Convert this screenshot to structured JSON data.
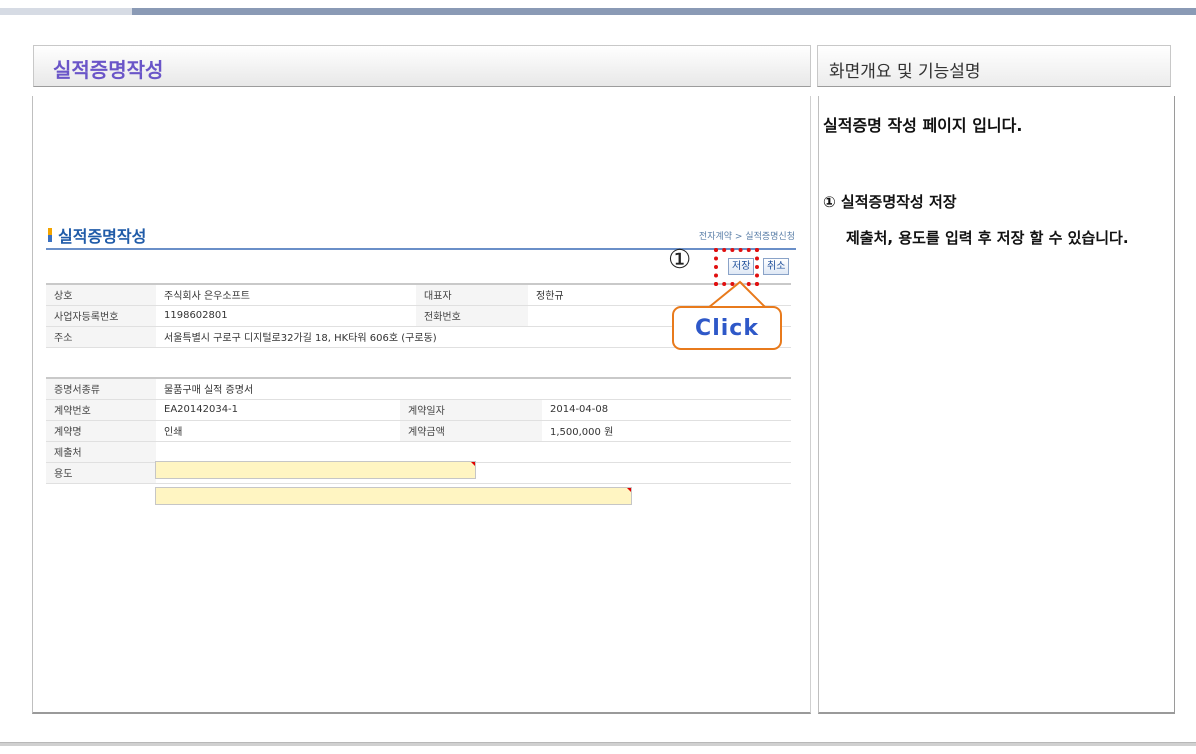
{
  "left_panel": {
    "title": "실적증명작성"
  },
  "right_panel": {
    "title": "화면개요 및 기능설명",
    "description": "실적증명 작성 페이지 입니다.",
    "item_title": "① 실적증명작성 저장",
    "item_desc": "제출처, 용도를 입력 후 저장 할 수 있습니다."
  },
  "screen": {
    "title": "실적증명작성",
    "breadcrumb": "전자계약 > 실적증명신청",
    "buttons": {
      "save": "저장",
      "cancel": "취소"
    },
    "company": {
      "name_label": "상호",
      "name_value": "주식회사 은우소프트",
      "ceo_label": "대표자",
      "ceo_value": "정한규",
      "bizno_label": "사업자등록번호",
      "bizno_value": "1198602801",
      "phone_label": "전화번호",
      "phone_value": "",
      "addr_label": "주소",
      "addr_value": "서울특별시 구로구 디지털로32가길 18, HK타워 606호 (구로동)"
    },
    "contract": {
      "cert_type_label": "증명서종류",
      "cert_type_value": "물품구매 실적 증명서",
      "no_label": "계약번호",
      "no_value": "EA20142034-1",
      "date_label": "계약일자",
      "date_value": "2014-04-08",
      "name_label": "계약명",
      "name_value": "인쇄",
      "amount_label": "계약금액",
      "amount_value": "1,500,000 원",
      "submit_label": "제출처",
      "submit_value": "",
      "purpose_label": "용도",
      "purpose_value": ""
    }
  },
  "annotation": {
    "marker": "①",
    "callout": "Click"
  },
  "colors": {
    "title_purple": "#6a55c8",
    "screen_title_blue": "#1f5ba8",
    "highlight_red": "#e01010",
    "callout_orange": "#e87a1c",
    "callout_text": "#2e58c8",
    "input_yellow": "#fff5c2"
  }
}
